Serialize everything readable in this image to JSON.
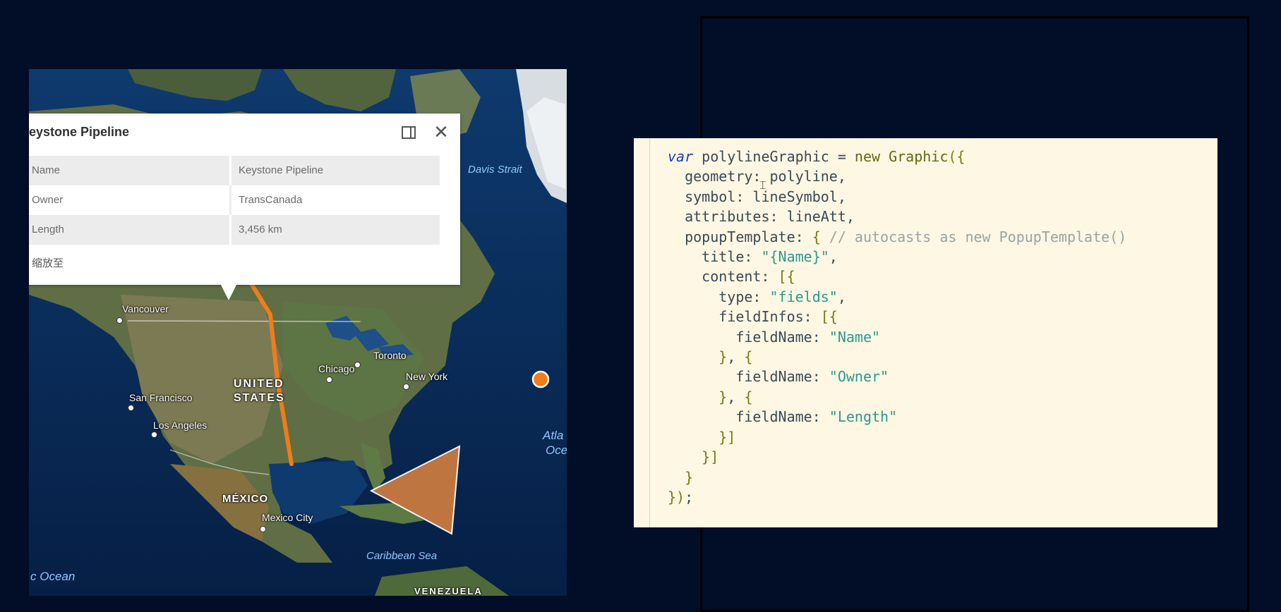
{
  "popup": {
    "title": "eystone Pipeline",
    "fields": [
      {
        "key": "Name",
        "value": "Keystone Pipeline"
      },
      {
        "key": "Owner",
        "value": "TransCanada"
      },
      {
        "key": "Length",
        "value": "3,456 km"
      }
    ],
    "zoom_link": "缩放至",
    "dock_icon": "dock-icon",
    "close_icon": "close-icon"
  },
  "map": {
    "labels": {
      "davis": "Davis Strait",
      "vancouver": "Vancouver",
      "toronto": "Toronto",
      "chicago": "Chicago",
      "newyork": "New York",
      "united": "UNITED",
      "states": "STATES",
      "sanfrancisco": "San Francisco",
      "losangeles": "Los Angeles",
      "mexico": "MÉXICO",
      "mexicocity": "Mexico City",
      "caribbean": "Caribbean Sea",
      "atlantic1": "Atla",
      "atlantic2": "Oce",
      "pacific": "c Ocean",
      "venezuela": "VENEZUELA"
    },
    "graphics_color": "#f07c1c"
  },
  "code": {
    "lines": [
      "var polylineGraphic = new Graphic({",
      "  geometry: polyline,",
      "  symbol: lineSymbol,",
      "  attributes: lineAtt,",
      "  popupTemplate: { // autocasts as new PopupTemplate()",
      "    title: \"{Name}\",",
      "    content: [{",
      "      type: \"fields\",",
      "      fieldInfos: [{",
      "        fieldName: \"Name\"",
      "      }, {",
      "        fieldName: \"Owner\"",
      "      }, {",
      "        fieldName: \"Length\"",
      "      }]",
      "    }]",
      "  }",
      "});"
    ]
  }
}
